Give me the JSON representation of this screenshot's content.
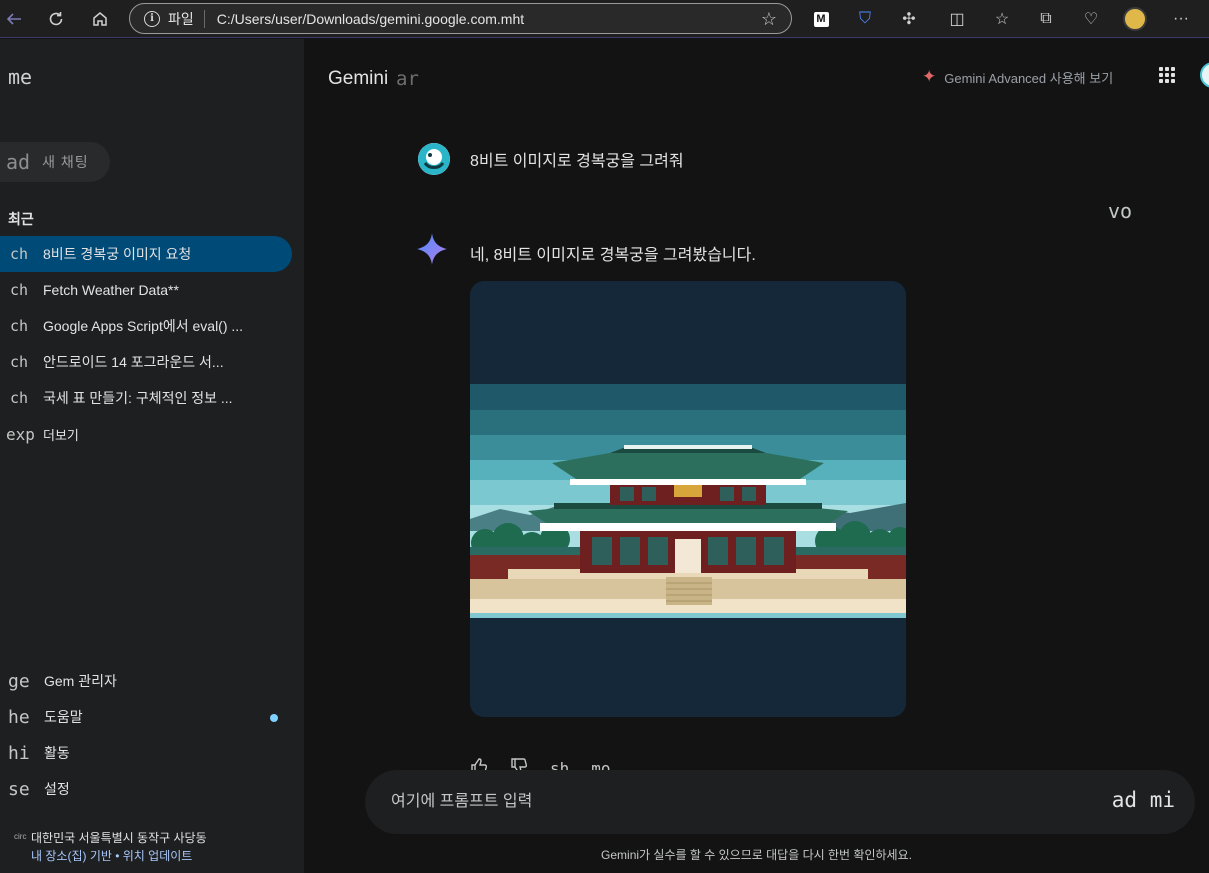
{
  "browser": {
    "back_icon": "arrow-left-icon",
    "address_scheme": "파일",
    "address_url": "C:/Users/user/Downloads/gemini.google.com.mht",
    "extensions": [
      "m-extension-icon",
      "shield-extension-icon",
      "puzzle-icon",
      "split-screen-icon",
      "favorites-icon",
      "collections-icon",
      "heart-pulse-icon",
      "profile-icon",
      "more-icon"
    ]
  },
  "sidebar": {
    "menu_label": "me",
    "new_chat_icon": "ad",
    "new_chat_label": "새 채팅",
    "recent_title": "최근",
    "chats": [
      {
        "icon": "ch",
        "label": "8비트 경복궁 이미지 요청"
      },
      {
        "icon": "ch",
        "label": "Fetch Weather Data**"
      },
      {
        "icon": "ch",
        "label": "Google Apps Script에서 eval() ..."
      },
      {
        "icon": "ch",
        "label": "안드로이드 14 포그라운드 서..."
      },
      {
        "icon": "ch",
        "label": "국세 표 만들기: 구체적인 정보 ..."
      }
    ],
    "more_icon": "exp",
    "more_label": "더보기",
    "bottom": [
      {
        "icon": "ge",
        "label": "Gem 관리자"
      },
      {
        "icon": "he",
        "label": "도움말"
      },
      {
        "icon": "hi",
        "label": "활동"
      },
      {
        "icon": "se",
        "label": "설정"
      }
    ],
    "location_icon": "circ",
    "location": "대한민국 서울특별시 동작구 사당동",
    "location_link": "내 장소(집) 기반 • 위치 업데이트"
  },
  "header": {
    "brand": "Gemini",
    "brand_suffix": "ar",
    "advanced_label": "Gemini Advanced 사용해 보기"
  },
  "conversation": {
    "user_message": "8비트 이미지로 경복궁을 그려줘",
    "voice_label": "vo",
    "reply_text": "네, 8비트 이미지로 경복궁을 그려봤습니다.",
    "actions": [
      "thumb-up-icon",
      "thumb-down-icon",
      "sh",
      "mo"
    ],
    "action_labels": [
      "sh",
      "mo"
    ]
  },
  "prompt": {
    "placeholder": "여기에 프롬프트 입력",
    "tools": "ad mi"
  },
  "disclaimer": "Gemini가 실수를 할 수 있으므로 대답을 다시 한번 확인하세요.",
  "colors": {
    "active_chat": "#004a77",
    "sidebar_bg": "#1e1f20",
    "main_bg": "#131314",
    "accent_spark": "#e06868"
  }
}
